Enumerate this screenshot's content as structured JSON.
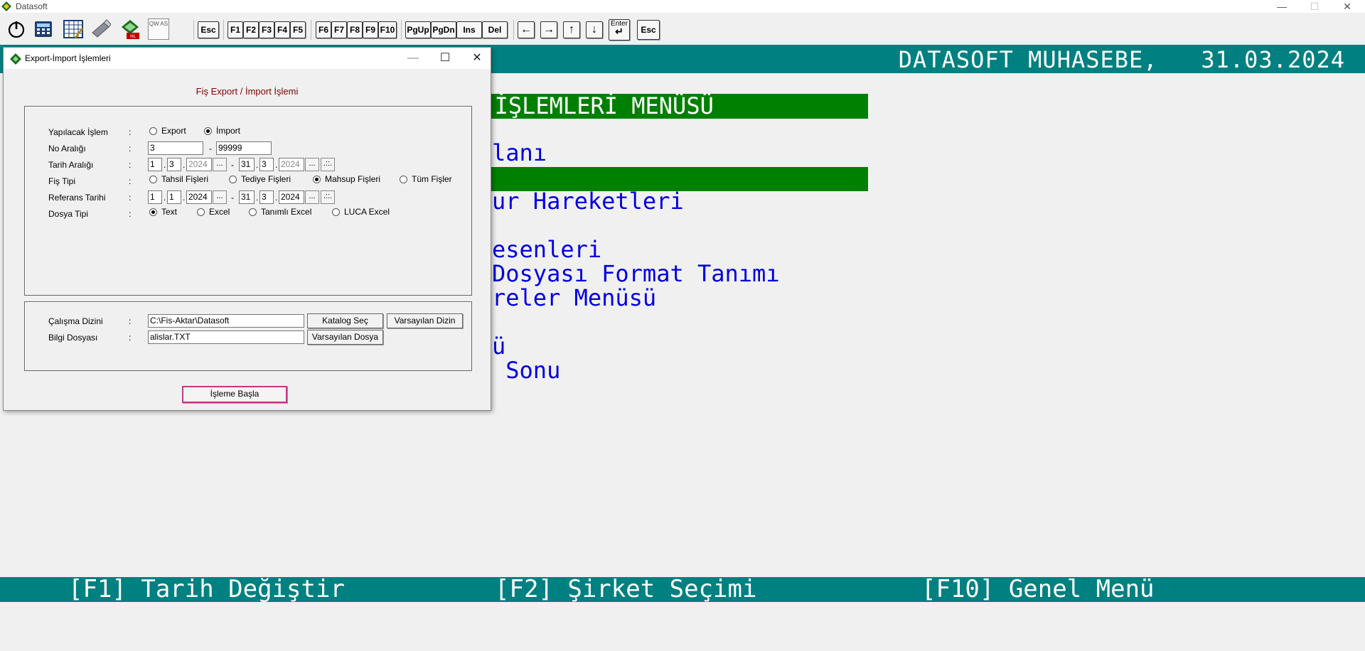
{
  "app": {
    "title": "Datasoft",
    "minimize_glyph": "—",
    "maximize_glyph": "☐",
    "close_glyph": "✕"
  },
  "toolbar": {
    "icons": [
      "power-icon",
      "calculator-icon",
      "spreadsheet-icon",
      "usb-drive-icon",
      "report-icon",
      "keyboard-icon"
    ],
    "buttons": [
      "Esc",
      "F1",
      "F2",
      "F3",
      "F4",
      "F5",
      "F6",
      "F7",
      "F8",
      "F9",
      "F10",
      "PgUp",
      "PgDn",
      "Ins",
      "Del"
    ],
    "arrow_left": "←",
    "arrow_right": "→",
    "arrow_up": "↑",
    "arrow_down": "↓",
    "enter_label": "Enter",
    "enter_glyph": "↵",
    "esc2": "Esc",
    "keyboard_glyph": "QW AS"
  },
  "header": {
    "text": "DATASOFT MUHASEBE,   31.03.2024"
  },
  "menu": {
    "title": "PORT  İŞLEMLERİ MENÜSÜ",
    "items": [
      "lanı",
      "",
      "ur Hareketleri",
      "",
      "esenleri",
      "Dosyası Format Tanımı",
      "reler Menüsü",
      "",
      "ü",
      " Sonu"
    ]
  },
  "footer": {
    "f1": "[F1] Tarih Değiştir",
    "f2": "[F2] Şirket Seçimi",
    "f10": "[F10] Genel Menü"
  },
  "dialog": {
    "title": "Export-İmport İşlemleri",
    "heading": "Fiş Export / İmport İşlemi",
    "minimize_glyph": "—",
    "maximize_glyph": "☐",
    "close_glyph": "✕",
    "colon": ":",
    "yapilacak": {
      "label": "Yapılacak İşlem",
      "options": [
        "Export",
        "İmport"
      ],
      "selected": "İmport"
    },
    "no_araligi": {
      "label": "No Aralığı",
      "from": "3",
      "sep": "-",
      "to": "99999"
    },
    "tarih_araligi": {
      "label": "Tarih Aralığı",
      "from_day": "1",
      "from_month": "3",
      "from_year": "2024",
      "to_day": "31",
      "to_month": "3",
      "to_year": "2024",
      "sep": "-",
      "dots_btn": "...",
      "cal_btn": ".::."
    },
    "fis_tipi": {
      "label": "Fiş Tipi",
      "options": [
        "Tahsil Fişleri",
        "Tediye Fişleri",
        "Mahsup Fişleri",
        "Tüm Fişler"
      ],
      "selected": "Mahsup Fişleri"
    },
    "referans_tarihi": {
      "label": "Referans Tarihi",
      "from_day": "1",
      "from_month": "1",
      "from_year": "2024",
      "to_day": "31",
      "to_month": "3",
      "to_year": "2024",
      "sep": "-",
      "dots_btn": "...",
      "cal_btn": ".::."
    },
    "dosya_tipi": {
      "label": "Dosya Tipi",
      "options": [
        "Text",
        "Excel",
        "Tanımlı Excel",
        "LUCA Excel"
      ],
      "selected": "Text"
    },
    "calisma_dizini": {
      "label": "Çalışma Dizini",
      "value": "C:\\Fis-Aktar\\Datasoft",
      "katalog_btn": "Katalog Seç",
      "varsayilan_dizin_btn": "Varsayılan Dizin"
    },
    "bilgi_dosyasi": {
      "label": "Bilgi Dosyası",
      "value": "alislar.TXT",
      "varsayilan_dosya_btn": "Varsayılan Dosya"
    },
    "start_btn": "İşleme Başla"
  },
  "colors": {
    "teal": "#008080",
    "menu_green": "#008000",
    "menu_text": "#0000e0",
    "heading": "#800000",
    "start_border": "#c0398a"
  }
}
